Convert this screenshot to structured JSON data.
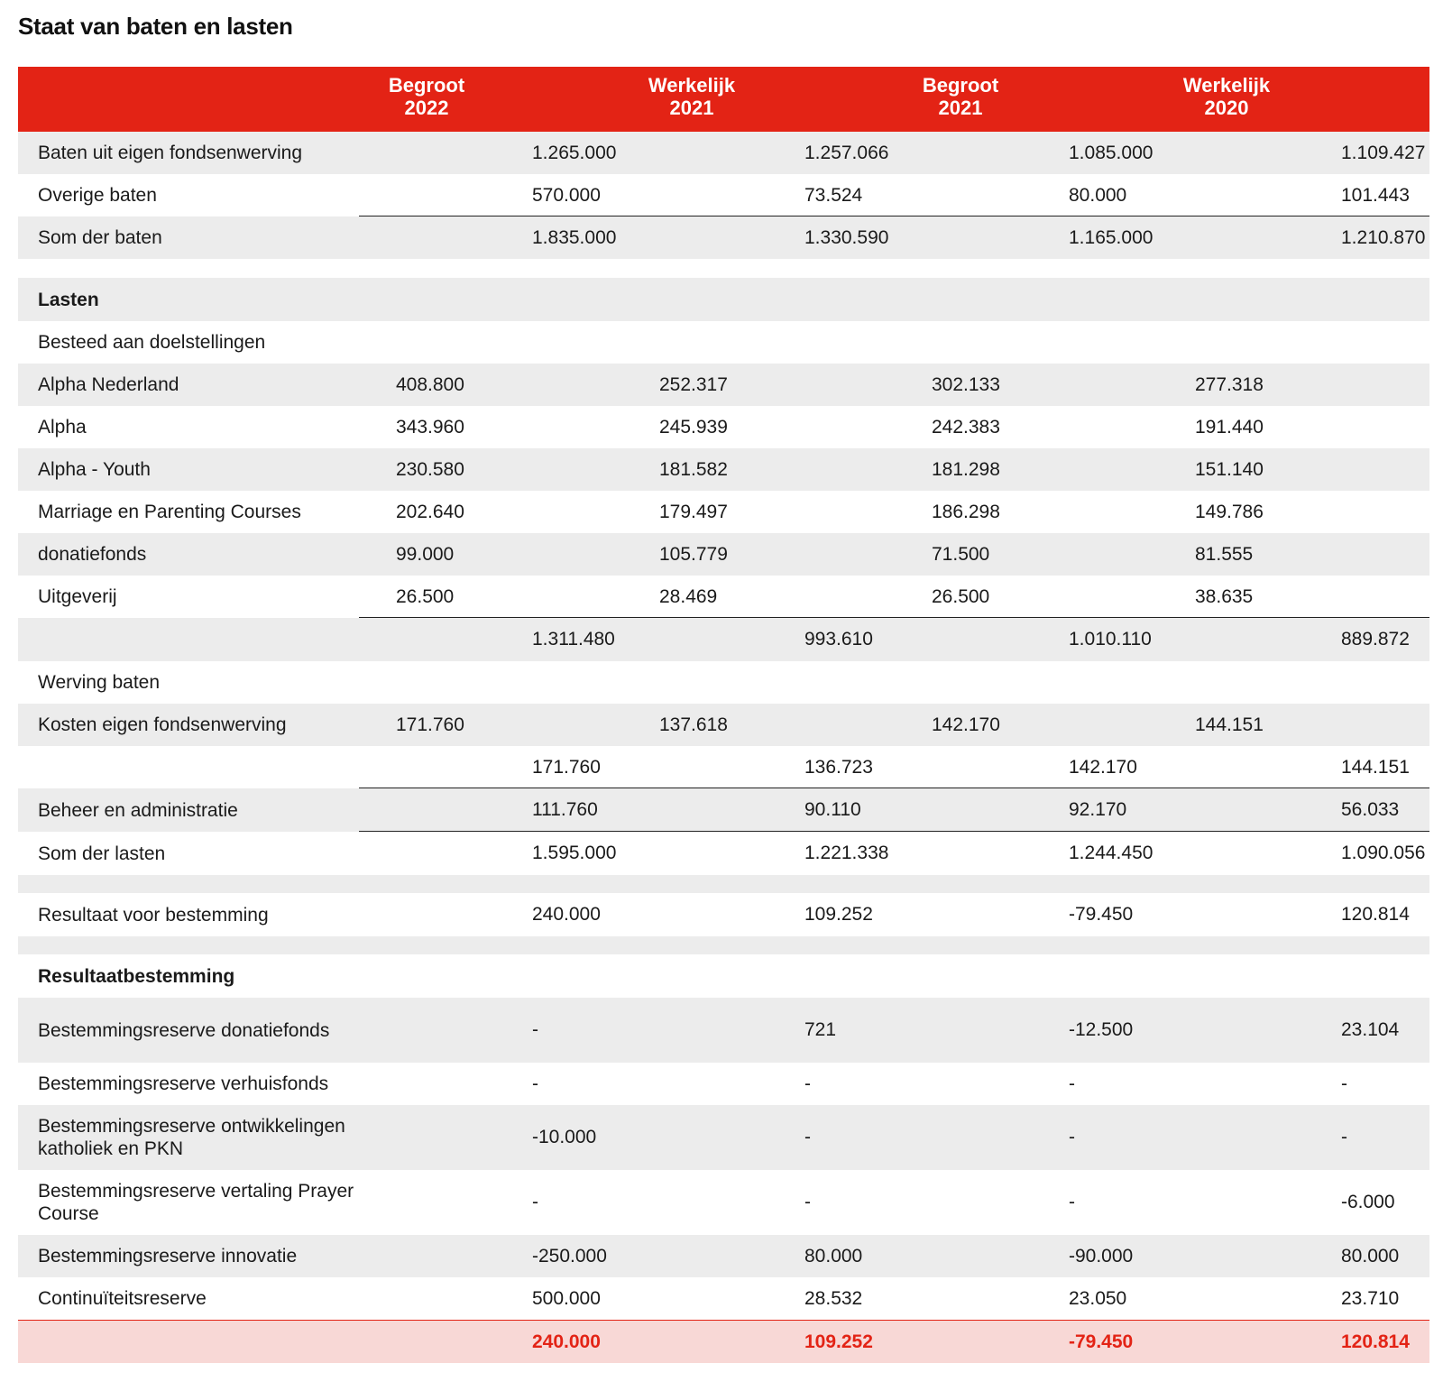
{
  "title": "Staat van baten en lasten",
  "header": [
    {
      "line1": "Begroot",
      "line2": "2022"
    },
    {
      "line1": "Werkelijk",
      "line2": "2021"
    },
    {
      "line1": "Begroot",
      "line2": "2021"
    },
    {
      "line1": "Werkelijk",
      "line2": "2020"
    }
  ],
  "baten": {
    "eigen": {
      "label": "Baten uit eigen fondsenwerving",
      "v": [
        "1.265.000",
        "1.257.066",
        "1.085.000",
        "1.109.427"
      ]
    },
    "overige": {
      "label": "Overige baten",
      "v": [
        "570.000",
        "73.524",
        "80.000",
        "101.443"
      ]
    },
    "som": {
      "label": "Som der baten",
      "v": [
        "1.835.000",
        "1.330.590",
        "1.165.000",
        "1.210.870"
      ]
    }
  },
  "lasten_heading": "Lasten",
  "besteed_heading": "Besteed aan doelstellingen",
  "doel": [
    {
      "label": "Alpha Nederland",
      "v": [
        "408.800",
        "252.317",
        "302.133",
        "277.318"
      ]
    },
    {
      "label": "Alpha",
      "v": [
        "343.960",
        "245.939",
        "242.383",
        "191.440"
      ]
    },
    {
      "label": "Alpha - Youth",
      "v": [
        "230.580",
        "181.582",
        "181.298",
        "151.140"
      ]
    },
    {
      "label": "Marriage en Parenting Courses",
      "v": [
        "202.640",
        "179.497",
        "186.298",
        "149.786"
      ]
    },
    {
      "label": "donatiefonds",
      "v": [
        "99.000",
        "105.779",
        "71.500",
        "81.555"
      ]
    },
    {
      "label": "Uitgeverij",
      "v": [
        "26.500",
        "28.469",
        "26.500",
        "38.635"
      ]
    }
  ],
  "doel_total": [
    "1.311.480",
    "993.610",
    "1.010.110",
    "889.872"
  ],
  "werving_heading": "Werving baten",
  "kosten": {
    "label": "Kosten eigen fondsenwerving",
    "v": [
      "171.760",
      "137.618",
      "142.170",
      "144.151"
    ]
  },
  "werving_total": [
    "171.760",
    "136.723",
    "142.170",
    "144.151"
  ],
  "beheer": {
    "label": "Beheer en administratie",
    "v": [
      "111.760",
      "90.110",
      "92.170",
      "56.033"
    ]
  },
  "som_lasten": {
    "label": "Som der lasten",
    "v": [
      "1.595.000",
      "1.221.338",
      "1.244.450",
      "1.090.056"
    ]
  },
  "resultaat": {
    "label": "Resultaat voor bestemming",
    "v": [
      "240.000",
      "109.252",
      "-79.450",
      "120.814"
    ]
  },
  "bestemming_heading": "Resultaatbestemming",
  "bestemming": [
    {
      "label": "Bestemmingsreserve donatiefonds",
      "v": [
        "-",
        "721",
        "-12.500",
        "23.104"
      ]
    },
    {
      "label": "Bestemmingsreserve verhuisfonds",
      "v": [
        "-",
        "-",
        "-",
        "-"
      ]
    },
    {
      "label": "Bestemmingsreserve ontwikkelingen katholiek en PKN",
      "v": [
        "-10.000",
        "-",
        "-",
        "-"
      ]
    },
    {
      "label": "Bestemmingsreserve vertaling Prayer Course",
      "v": [
        "-",
        "-",
        "-",
        "-6.000"
      ]
    },
    {
      "label": "Bestemmingsreserve innovatie",
      "v": [
        "-250.000",
        "80.000",
        "-90.000",
        "80.000"
      ]
    },
    {
      "label": "Continuïteitsreserve",
      "v": [
        "500.000",
        "28.532",
        "23.050",
        "23.710"
      ]
    }
  ],
  "final_total": [
    "240.000",
    "109.252",
    "-79.450",
    "120.814"
  ]
}
